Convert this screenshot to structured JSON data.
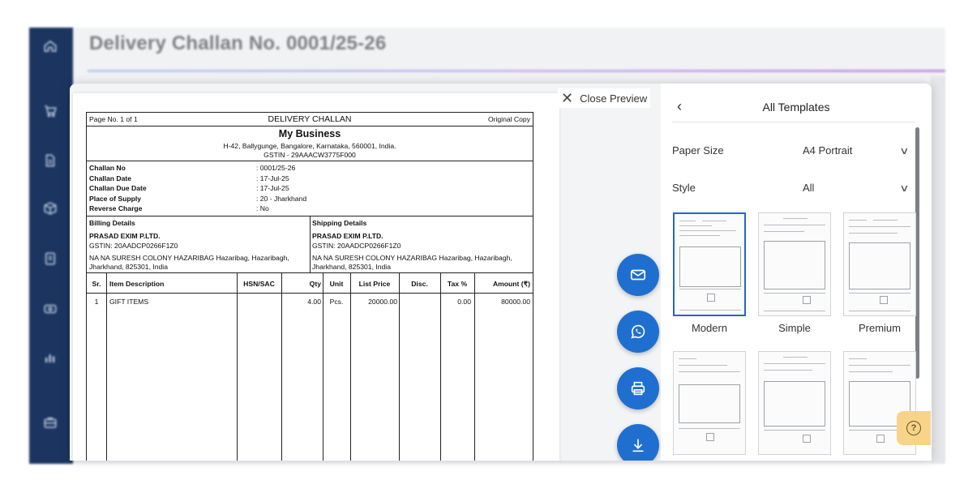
{
  "background": {
    "title": "Delivery Challan No. 0001/25-26",
    "sidebar_icons": [
      "home-icon",
      "cart-icon",
      "document-icon",
      "box-icon",
      "invoice-icon",
      "payments-icon",
      "reports-icon",
      "briefcase-icon"
    ]
  },
  "preview": {
    "close_label": "Close Preview"
  },
  "document": {
    "page_no": "Page No. 1 of 1",
    "doc_title": "DELIVERY CHALLAN",
    "copy_type": "Original Copy",
    "business_name": "My Business",
    "business_address": "H-42, Ballygunge, Bangalore, Karnataka, 560001, India.",
    "business_gstin": "GSTIN - 29AAACW3775F000",
    "meta": [
      {
        "label": "Challan No",
        "value": ": 0001/25-26"
      },
      {
        "label": "Challan Date",
        "value": ": 17-Jul-25"
      },
      {
        "label": "Challan Due Date",
        "value": ": 17-Jul-25"
      },
      {
        "label": "Place of Supply",
        "value": ": 20 - Jharkhand"
      },
      {
        "label": "Reverse Charge",
        "value": ": No"
      }
    ],
    "billing": {
      "heading": "Billing Details",
      "name": "PRASAD EXIM P.LTD.",
      "gstin": "GSTIN: 20AADCP0266F1Z0",
      "address_1": "NA NA SURESH COLONY HAZARIBAG Hazaribag, Hazaribagh,",
      "address_2": "Jharkhand, 825301, India"
    },
    "shipping": {
      "heading": "Shipping Details",
      "name": "PRASAD EXIM P.LTD.",
      "gstin": "GSTIN: 20AADCP0266F1Z0",
      "address_1": "NA NA SURESH COLONY HAZARIBAG Hazaribag, Hazaribagh,",
      "address_2": "Jharkhand, 825301, India"
    },
    "columns": [
      "Sr.",
      "Item Description",
      "HSN/SAC",
      "Qty",
      "Unit",
      "List Price",
      "Disc.",
      "Tax %",
      "Amount (₹)"
    ],
    "items": [
      {
        "sr": "1",
        "description": "GIFT ITEMS",
        "hsn": "",
        "qty": "4.00",
        "unit": "Pcs.",
        "list_price": "20000.00",
        "disc": "",
        "tax": "0.00",
        "amount": "80000.00"
      }
    ]
  },
  "actions": [
    {
      "name": "email-button",
      "icon": "mail-icon"
    },
    {
      "name": "whatsapp-button",
      "icon": "whatsapp-icon"
    },
    {
      "name": "print-button",
      "icon": "printer-icon"
    },
    {
      "name": "download-button",
      "icon": "download-icon"
    }
  ],
  "templates": {
    "title": "All Templates",
    "paper_size_label": "Paper Size",
    "paper_size_value": "A4 Portrait",
    "style_label": "Style",
    "style_value": "All",
    "items": [
      {
        "name": "Modern",
        "selected": true
      },
      {
        "name": "Simple",
        "selected": false
      },
      {
        "name": "Premium",
        "selected": false
      },
      {
        "name": "",
        "selected": false
      },
      {
        "name": "",
        "selected": false
      },
      {
        "name": "",
        "selected": false
      }
    ]
  },
  "colors": {
    "sidebar": "#1b3560",
    "primary": "#1f6fd0",
    "help": "#f7d48a"
  }
}
